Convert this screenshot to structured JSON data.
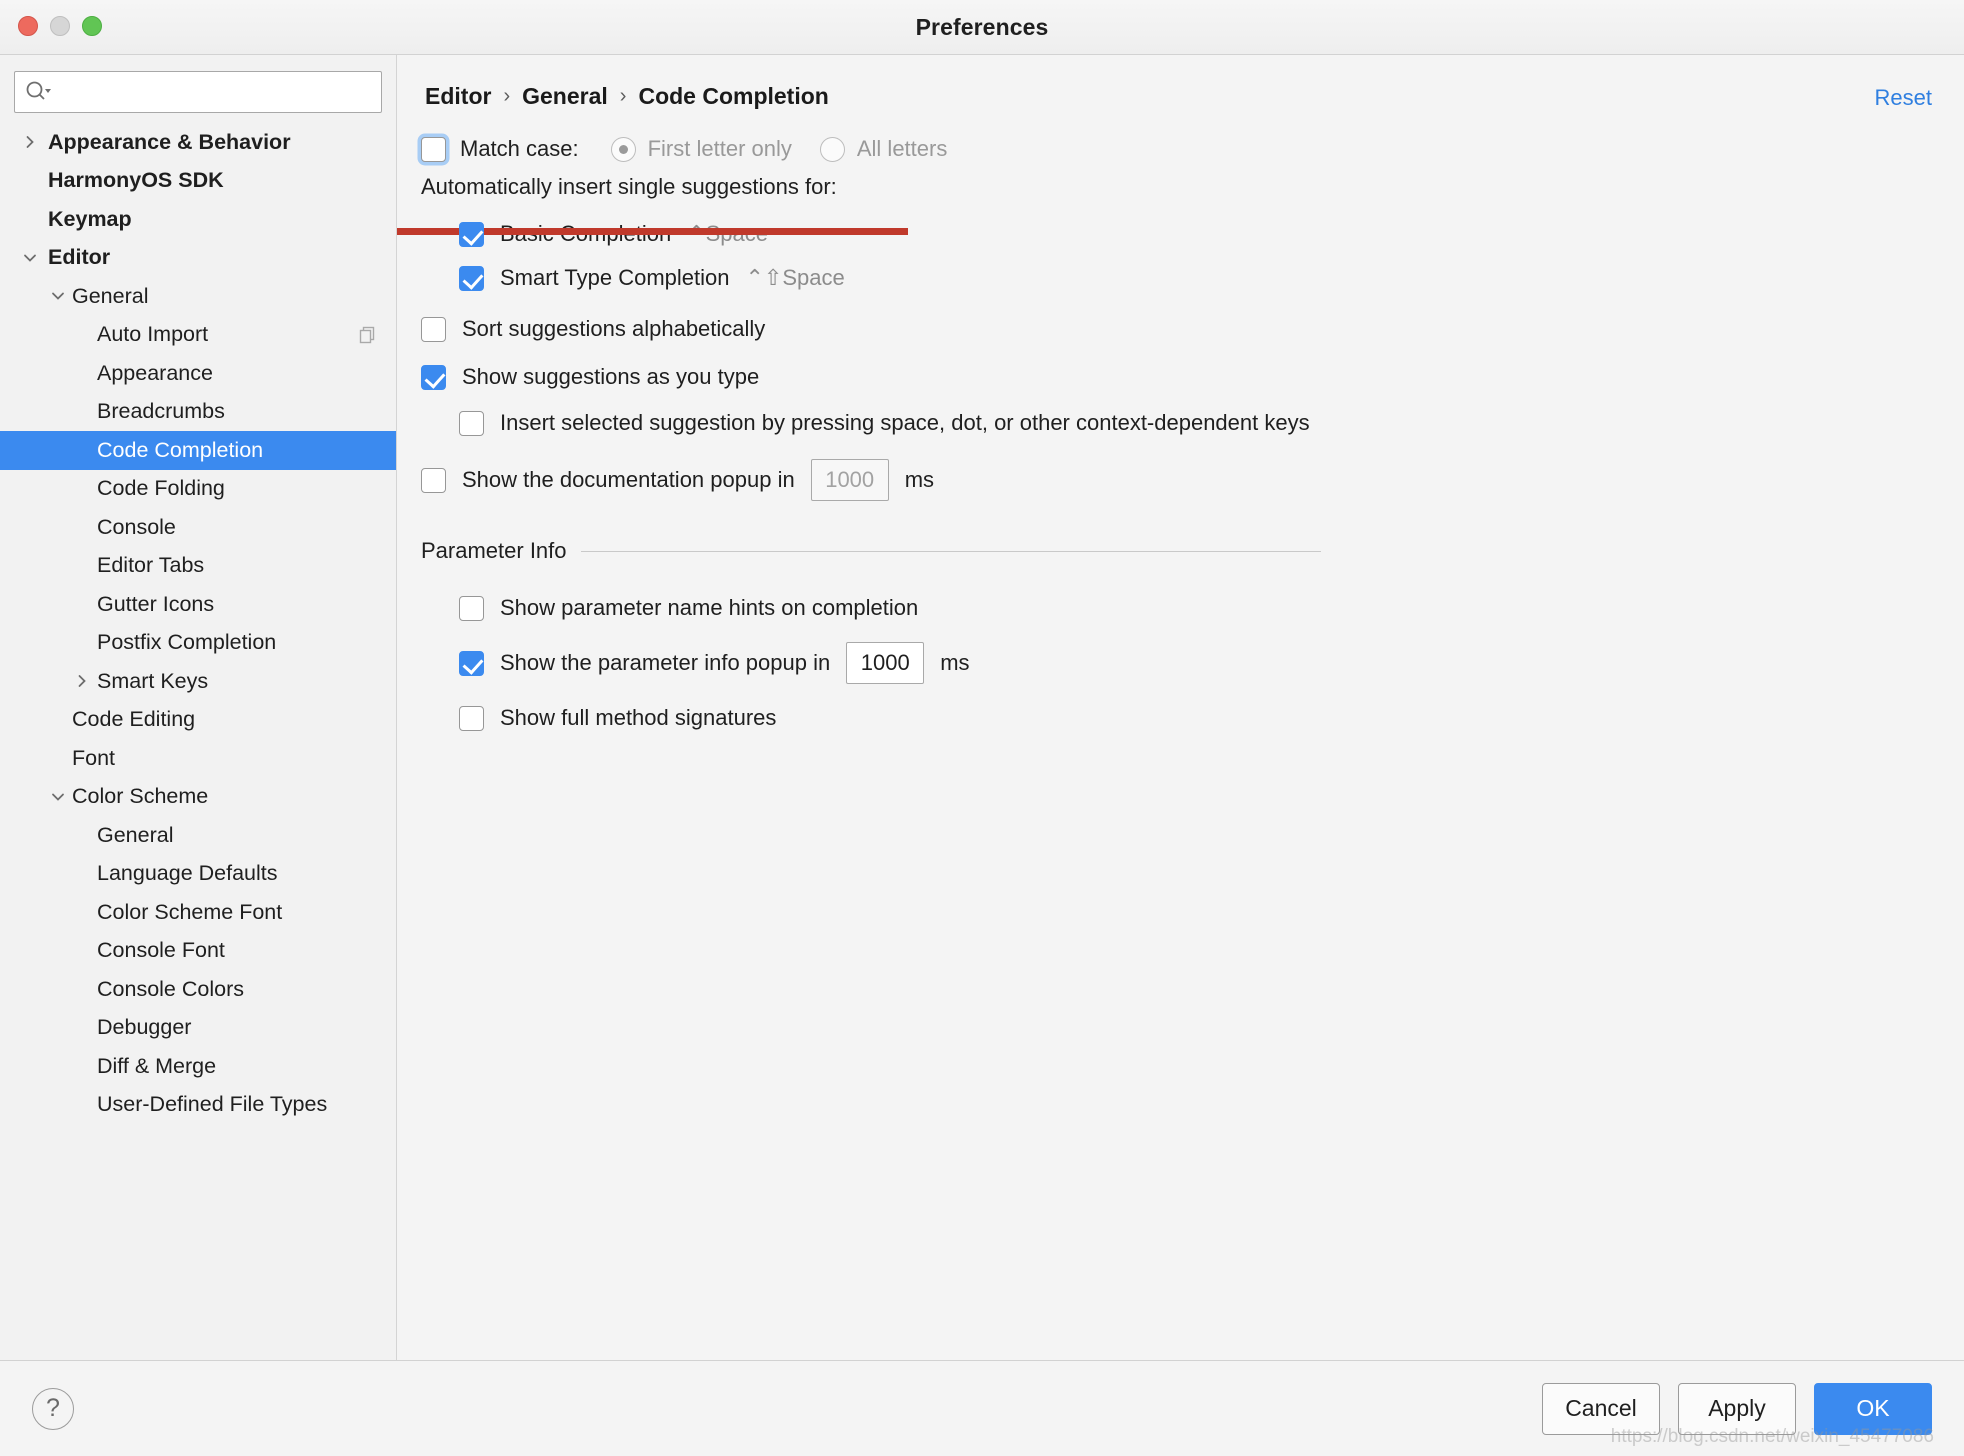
{
  "window": {
    "title": "Preferences",
    "traffic_lights": [
      "close-red",
      "minimize-yellow",
      "maximize-green"
    ]
  },
  "sidebar": {
    "search": {
      "value": "",
      "placeholder": "",
      "icon": "search-icon-with-dropdown"
    },
    "items": [
      {
        "label": "Appearance & Behavior",
        "level": 0,
        "twisty": "right",
        "bold": true
      },
      {
        "label": "HarmonyOS SDK",
        "level": 0,
        "twisty": "none",
        "bold": true
      },
      {
        "label": "Keymap",
        "level": 0,
        "twisty": "none",
        "bold": true
      },
      {
        "label": "Editor",
        "level": 0,
        "twisty": "down",
        "bold": true
      },
      {
        "label": "General",
        "level": 1,
        "twisty": "down",
        "bold": false
      },
      {
        "label": "Auto Import",
        "level": 2,
        "twisty": "none",
        "bold": false,
        "badge": "copy-icon"
      },
      {
        "label": "Appearance",
        "level": 2,
        "twisty": "none",
        "bold": false
      },
      {
        "label": "Breadcrumbs",
        "level": 2,
        "twisty": "none",
        "bold": false
      },
      {
        "label": "Code Completion",
        "level": 2,
        "twisty": "none",
        "bold": false,
        "selected": true
      },
      {
        "label": "Code Folding",
        "level": 2,
        "twisty": "none",
        "bold": false
      },
      {
        "label": "Console",
        "level": 2,
        "twisty": "none",
        "bold": false
      },
      {
        "label": "Editor Tabs",
        "level": 2,
        "twisty": "none",
        "bold": false
      },
      {
        "label": "Gutter Icons",
        "level": 2,
        "twisty": "none",
        "bold": false
      },
      {
        "label": "Postfix Completion",
        "level": 2,
        "twisty": "none",
        "bold": false
      },
      {
        "label": "Smart Keys",
        "level": 2,
        "twisty": "right",
        "bold": false
      },
      {
        "label": "Code Editing",
        "level": 1,
        "twisty": "none",
        "bold": false
      },
      {
        "label": "Font",
        "level": 1,
        "twisty": "none",
        "bold": false
      },
      {
        "label": "Color Scheme",
        "level": 1,
        "twisty": "down",
        "bold": false
      },
      {
        "label": "General",
        "level": 2,
        "twisty": "none",
        "bold": false
      },
      {
        "label": "Language Defaults",
        "level": 2,
        "twisty": "none",
        "bold": false
      },
      {
        "label": "Color Scheme Font",
        "level": 2,
        "twisty": "none",
        "bold": false
      },
      {
        "label": "Console Font",
        "level": 2,
        "twisty": "none",
        "bold": false
      },
      {
        "label": "Console Colors",
        "level": 2,
        "twisty": "none",
        "bold": false
      },
      {
        "label": "Debugger",
        "level": 2,
        "twisty": "none",
        "bold": false
      },
      {
        "label": "Diff & Merge",
        "level": 2,
        "twisty": "none",
        "bold": false
      },
      {
        "label": "User-Defined File Types",
        "level": 2,
        "twisty": "none",
        "bold": false
      }
    ]
  },
  "main": {
    "breadcrumb": {
      "part1": "Editor",
      "part2": "General",
      "part3": "Code Completion",
      "separator": "›"
    },
    "reset_label": "Reset",
    "match_case": {
      "label": "Match case:",
      "checked": false,
      "focused": true,
      "options": [
        {
          "label": "First letter only",
          "selected": true,
          "disabled": true
        },
        {
          "label": "All letters",
          "selected": false,
          "disabled": true
        }
      ]
    },
    "auto_insert": {
      "label": "Automatically insert single suggestions for:",
      "items": [
        {
          "label": "Basic Completion",
          "shortcut": "⌃Space",
          "checked": true
        },
        {
          "label": "Smart Type Completion",
          "shortcut": "⌃⇧Space",
          "checked": true
        }
      ]
    },
    "sort_alphabetically": {
      "label": "Sort suggestions alphabetically",
      "checked": false
    },
    "show_as_you_type": {
      "label": "Show suggestions as you type",
      "checked": true
    },
    "insert_on_keys": {
      "label": "Insert selected suggestion by pressing space, dot, or other context-dependent keys",
      "checked": false
    },
    "doc_popup": {
      "label": "Show the documentation popup in",
      "checked": false,
      "value": "1000",
      "unit": "ms",
      "input_disabled": true
    },
    "parameter_info": {
      "header": "Parameter Info",
      "name_hints": {
        "label": "Show parameter name hints on completion",
        "checked": false
      },
      "popup_delay": {
        "label": "Show the parameter info popup in",
        "checked": true,
        "value": "1000",
        "unit": "ms",
        "input_disabled": false
      },
      "full_signatures": {
        "label": "Show full method signatures",
        "checked": false
      }
    },
    "annotation": {
      "color": "#c0392b",
      "type": "red-underline"
    }
  },
  "footer": {
    "help_glyph": "?",
    "cancel_label": "Cancel",
    "apply_label": "Apply",
    "ok_label": "OK"
  },
  "watermark": "https://blog.csdn.net/weixin_45477086"
}
